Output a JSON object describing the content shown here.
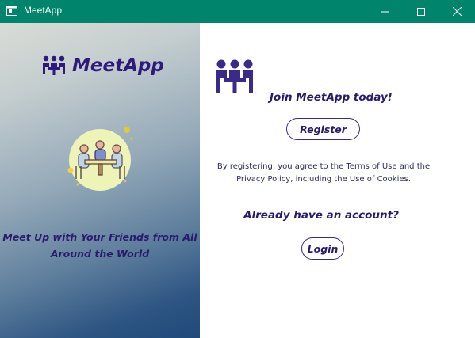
{
  "window": {
    "title": "MeetApp",
    "icons": {
      "app": "window-icon",
      "minimize": "minimize-icon",
      "maximize": "maximize-icon",
      "close": "close-icon"
    },
    "titlebar_color": "#00846c"
  },
  "left_panel": {
    "brand_name": "MeetApp",
    "brand_icon": "people-meeting-icon",
    "illustration": "meeting-table-illustration",
    "tagline": "Meet Up with Your Friends from All Around the World"
  },
  "right_panel": {
    "logo_icon": "people-meeting-icon",
    "join_heading": "Join MeetApp today!",
    "register_label": "Register",
    "terms_text": "By registering, you agree to the Terms of Use and the Privacy Policy, including the Use of Cookies.",
    "already_heading": "Already have an account?",
    "login_label": "Login"
  },
  "colors": {
    "accent": "#2a1a6f",
    "button_border": "#3a2a8a"
  }
}
